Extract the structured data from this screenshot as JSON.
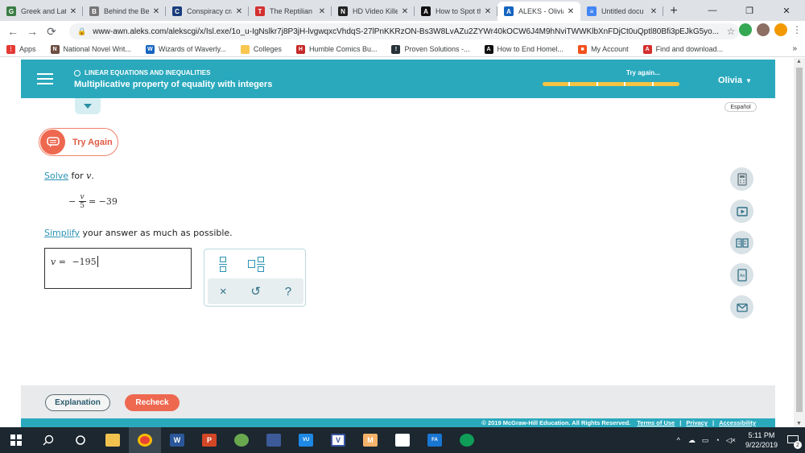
{
  "browser": {
    "tabs": [
      {
        "title": "Greek and Latin",
        "color": "#3a7d44",
        "glyph": "G",
        "active": false
      },
      {
        "title": "Behind the Bel",
        "color": "#777777",
        "glyph": "B",
        "active": false
      },
      {
        "title": "Conspiracy cra",
        "color": "#1a3d7c",
        "glyph": "C",
        "active": false
      },
      {
        "title": "The Reptilian E",
        "color": "#d32f2f",
        "glyph": "T",
        "active": false
      },
      {
        "title": "HD Video Kille",
        "color": "#222222",
        "glyph": "N",
        "active": false
      },
      {
        "title": "How to Spot th",
        "color": "#111111",
        "glyph": "A",
        "active": false
      },
      {
        "title": "ALEKS - Olivia",
        "color": "#1565c0",
        "glyph": "A",
        "active": true
      },
      {
        "title": "Untitled docu",
        "color": "#4285f4",
        "glyph": "≡",
        "active": false
      }
    ],
    "close_glyph": "✕",
    "new_tab": "+",
    "window_controls": [
      "—",
      "❐",
      "✕"
    ],
    "url": "www-awn.aleks.com/alekscgi/x/Isl.exe/1o_u-IgNslkr7j8P3jH-lvgwqxcVhdqS-27lPnKKRzON-Bs3W8LvAZu2ZYWr40kOCW6J4M9hNviTWWKlbXnFDjCt0uQptl80Bfi3pEJkG5yo...",
    "nav": {
      "back": "←",
      "forward": "→",
      "reload": "⟳",
      "lock": "🔒",
      "star": "☆",
      "menu": "⋮"
    },
    "bookmarks": [
      {
        "label": "Apps",
        "color": "#e53935",
        "glyph": "⋮"
      },
      {
        "label": "National Novel Writ...",
        "color": "#6d4c41",
        "glyph": "N"
      },
      {
        "label": "Wizards of Waverly...",
        "color": "#1565c0",
        "glyph": "W"
      },
      {
        "label": "Colleges",
        "color": "#f9c74f",
        "glyph": ""
      },
      {
        "label": "Humble Comics Bu...",
        "color": "#c62828",
        "glyph": "H"
      },
      {
        "label": "Proven Solutions -...",
        "color": "#263238",
        "glyph": "!"
      },
      {
        "label": "How to End Homel...",
        "color": "#111111",
        "glyph": "A"
      },
      {
        "label": "My Account",
        "color": "#f4511e",
        "glyph": "■"
      },
      {
        "label": "Find and download...",
        "color": "#d32f2f",
        "glyph": "A"
      }
    ],
    "bookmarks_more": "»"
  },
  "aleks": {
    "topic": "LINEAR EQUATIONS AND INEQUALITIES",
    "lesson": "Multiplicative property of equality with integers",
    "status": "Try again...",
    "progress_segments": 5,
    "user": "Olivia",
    "user_caret": "▼",
    "language": "Español",
    "try_again_button": "Try Again",
    "problem": {
      "instruction_link": "Solve",
      "instruction_rest": " for ",
      "variable": "v",
      "period": ".",
      "eq_minus": "−",
      "frac_num": "v",
      "frac_den": "5",
      "eq_rhs": " = −39",
      "simplify_link": "Simplify",
      "simplify_rest": " your answer as much as possible."
    },
    "answer": {
      "prefix_var": "v",
      "prefix_eq": " = ",
      "value": "−195"
    },
    "palette": {
      "clear": "×",
      "undo": "↺",
      "help": "?"
    },
    "buttons": {
      "explanation": "Explanation",
      "recheck": "Recheck"
    },
    "footer": {
      "copyright": "© 2019 McGraw-Hill Education. All Rights Reserved.",
      "terms": "Terms of Use",
      "privacy": "Privacy",
      "accessibility": "Accessibility",
      "sep": "|"
    }
  },
  "taskbar": {
    "time": "5:11 PM",
    "date": "9/22/2019",
    "notification_count": "2"
  },
  "colors": {
    "header": "#2aa9bd",
    "accent_orange": "#ee6850",
    "progress": "#f5c342"
  }
}
